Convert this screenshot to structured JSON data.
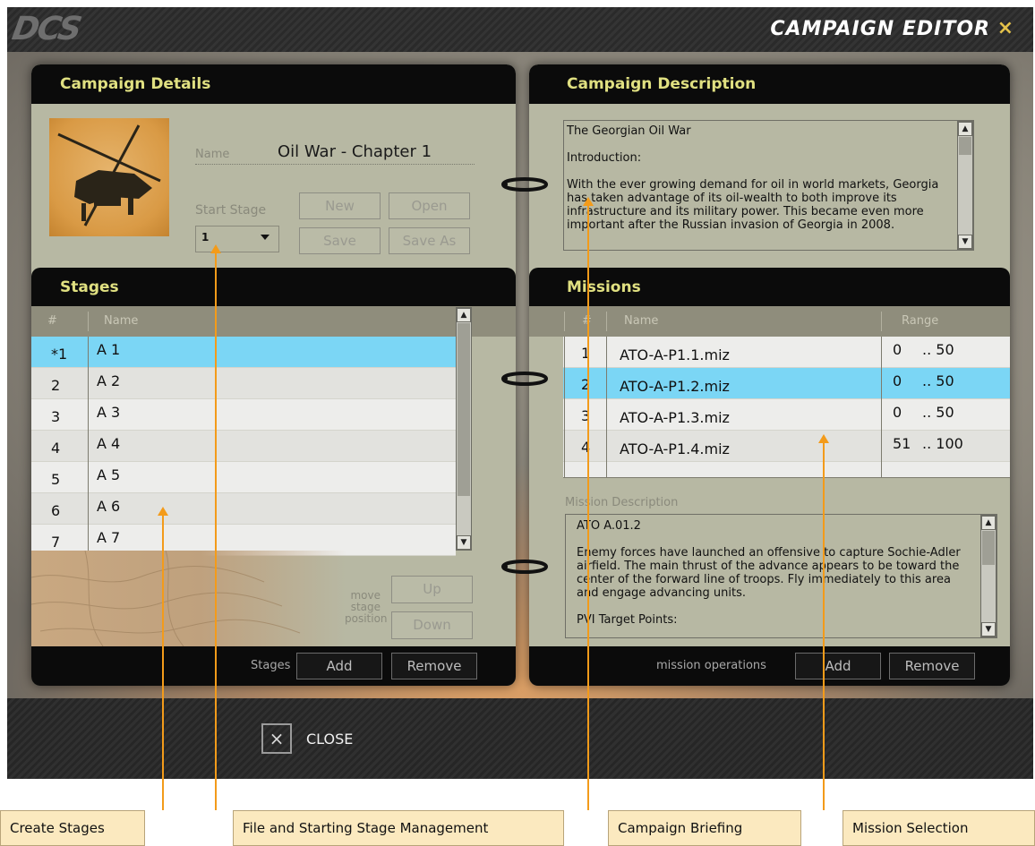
{
  "window": {
    "logo": "DCS",
    "title": "CAMPAIGN EDITOR",
    "close_icon": "×"
  },
  "campaign_details": {
    "header": "Campaign Details",
    "name_label": "Name",
    "name_value": "Oil War - Chapter 1",
    "start_stage_label": "Start Stage",
    "start_stage_value": "1",
    "buttons": {
      "new": "New",
      "open": "Open",
      "save": "Save",
      "save_as": "Save As"
    }
  },
  "stages": {
    "header": "Stages",
    "columns": {
      "num": "#",
      "name": "Name"
    },
    "rows": [
      {
        "num": "*1",
        "name": "A 1",
        "selected": true
      },
      {
        "num": "2",
        "name": "A 2"
      },
      {
        "num": "3",
        "name": "A 3"
      },
      {
        "num": "4",
        "name": "A 4"
      },
      {
        "num": "5",
        "name": "A 5"
      },
      {
        "num": "6",
        "name": "A 6"
      },
      {
        "num": "7",
        "name": "A 7"
      }
    ],
    "move_label": "move\nstage\nposition",
    "up_button": "Up",
    "down_button": "Down",
    "footer_label": "Stages",
    "add_button": "Add",
    "remove_button": "Remove"
  },
  "campaign_description": {
    "header": "Campaign Description",
    "paragraphs": [
      "The Georgian Oil War",
      "Introduction:",
      "With the ever growing demand for oil in world markets, Georgia has taken advantage of its oil-wealth to both improve its infrastructure and its military power.  This became even more important after the Russian invasion of Georgia in 2008."
    ]
  },
  "missions": {
    "header": "Missions",
    "columns": {
      "num": "#",
      "name": "Name",
      "range": "Range"
    },
    "rows": [
      {
        "num": "1",
        "name": "ATO-A-P1.1.miz",
        "range_min": "0",
        "range_max": ".. 50"
      },
      {
        "num": "2",
        "name": "ATO-A-P1.2.miz",
        "range_min": "0",
        "range_max": ".. 50",
        "selected": true
      },
      {
        "num": "3",
        "name": "ATO-A-P1.3.miz",
        "range_min": "0",
        "range_max": ".. 50"
      },
      {
        "num": "4",
        "name": "ATO-A-P1.4.miz",
        "range_min": "51",
        "range_max": ".. 100"
      }
    ],
    "description_label": "Mission Description",
    "description_paragraphs": [
      "ATO A.01.2",
      "Enemy forces have launched an offensive to capture Sochie-Adler airfield.  The main thrust of the advance appears to be toward the center of the forward line of troops. Fly immediately to this area and engage advancing units.",
      "PVI Target Points:"
    ],
    "footer_label": "mission operations",
    "add_button": "Add",
    "remove_button": "Remove"
  },
  "close_button": {
    "icon": "×",
    "label": "CLOSE"
  },
  "annotations": [
    "Create Stages",
    "File and Starting Stage Management",
    "Campaign Briefing",
    "Mission Selection"
  ],
  "colors": {
    "selection": "#7bd6f5",
    "header_text": "#e0e081",
    "panel": "#b7b8a3",
    "callout": "#f39b1a",
    "callout_box": "#fbe9bf"
  }
}
